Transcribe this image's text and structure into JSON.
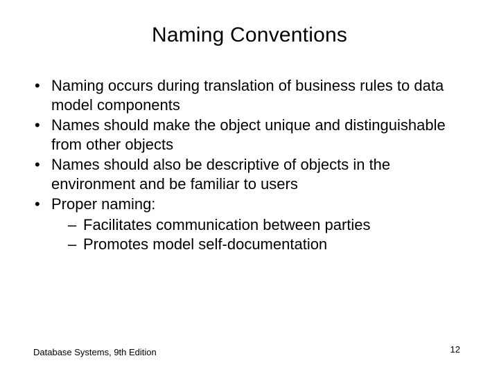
{
  "title": "Naming Conventions",
  "bullets": [
    {
      "text": "Naming occurs during translation of business rules to data model components"
    },
    {
      "text": "Names should make the object unique and distinguishable from other objects"
    },
    {
      "text": "Names should also be descriptive of objects in the environment and be familiar to users"
    },
    {
      "text": "Proper naming:",
      "sub": [
        "Facilitates communication between parties",
        "Promotes model self-documentation"
      ]
    }
  ],
  "footer": {
    "source": "Database Systems, 9th Edition",
    "page": "12"
  }
}
